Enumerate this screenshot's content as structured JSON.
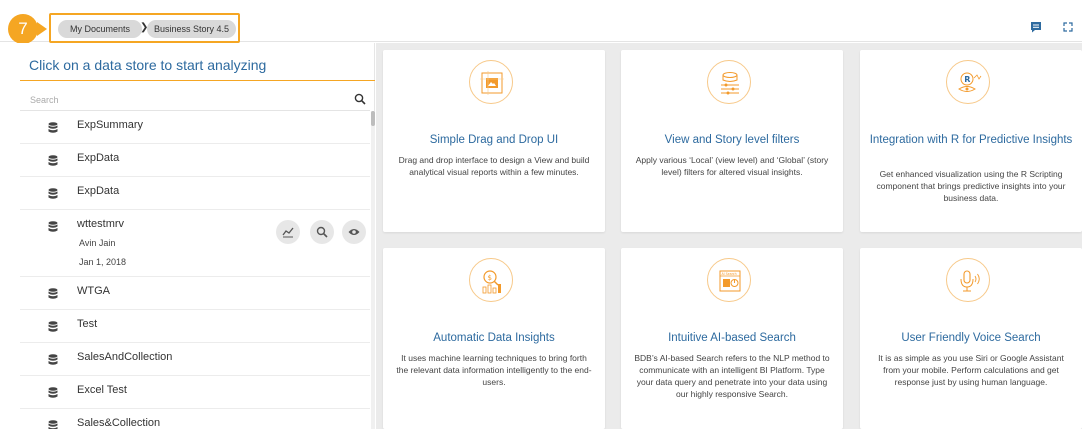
{
  "step_badge": "7",
  "breadcrumb": {
    "items": [
      "My Documents",
      "Business Story 4.5"
    ],
    "separator": "❯"
  },
  "left_panel": {
    "title": "Click on a data store to start analyzing",
    "search_placeholder": "Search",
    "datastores": [
      {
        "name": "ExpSummary"
      },
      {
        "name": "ExpData"
      },
      {
        "name": "ExpData"
      },
      {
        "name": "wttestmrv",
        "owner": "Avin Jain",
        "date": "Jan 1, 2018"
      },
      {
        "name": "WTGA"
      },
      {
        "name": "Test"
      },
      {
        "name": "SalesAndCollection"
      },
      {
        "name": "Excel Test"
      },
      {
        "name": "Sales&Collection"
      }
    ]
  },
  "features": [
    {
      "icon": "drag-drop-icon",
      "title": "Simple Drag and Drop UI",
      "desc": "Drag and drop interface to design a View and build analytical visual reports within a few minutes."
    },
    {
      "icon": "filter-icon",
      "title": "View and Story level filters",
      "desc": "Apply various ‘Local’ (view level) and ‘Global’ (story level) filters for altered visual insights."
    },
    {
      "icon": "r-integration-icon",
      "title": "Integration with R for Predictive Insights",
      "desc": "Get enhanced visualization using the R Scripting component that brings predictive insights into your business data."
    },
    {
      "icon": "data-insights-icon",
      "title": "Automatic Data Insights",
      "desc": "It uses machine learning techniques to bring forth the relevant data information intelligently to the end-users."
    },
    {
      "icon": "ai-search-icon",
      "title": "Intuitive AI-based Search",
      "desc": "BDB’s AI-based Search refers to the NLP method to communicate with an intelligent BI Platform. Type your data query and penetrate into your data using our highly responsive Search.",
      "icon_label": "AI Search"
    },
    {
      "icon": "voice-search-icon",
      "title": "User Friendly Voice Search",
      "desc": "It is as simple as you use Siri or Google Assistant from your mobile. Perform calculations and get response just by using human language."
    }
  ],
  "colors": {
    "accent": "#f5a623",
    "title_blue": "#2d6a9f",
    "icon_orange": "#f39a2b",
    "background": "#ebebeb"
  }
}
